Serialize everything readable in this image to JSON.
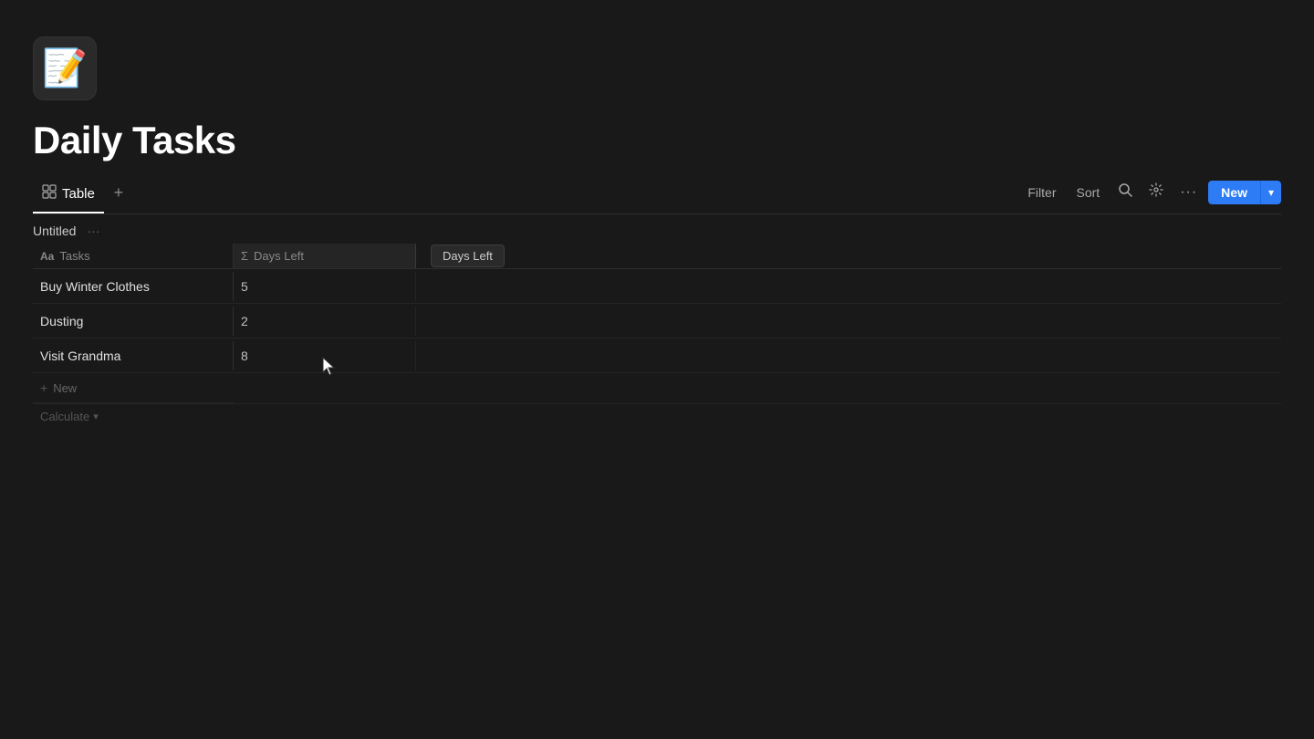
{
  "app": {
    "icon_emoji": "📝",
    "title": "Daily Tasks"
  },
  "tabs": [
    {
      "id": "table",
      "label": "Table",
      "active": true
    }
  ],
  "tabs_add_label": "+",
  "toolbar": {
    "filter_label": "Filter",
    "sort_label": "Sort",
    "search_icon": "🔍",
    "options_icon": "⚙",
    "more_icon": "···",
    "new_label": "New",
    "new_dropdown_icon": "▾"
  },
  "table": {
    "group_name": "Untitled",
    "group_more_icon": "···",
    "columns": [
      {
        "id": "tasks",
        "type_label": "Aa",
        "label": "Tasks"
      },
      {
        "id": "days_left",
        "type_label": "Σ",
        "label": "Days Left"
      }
    ],
    "column_pill_label": "Days Left",
    "rows": [
      {
        "task": "Buy Winter Clothes",
        "days_left": "5"
      },
      {
        "task": "Dusting",
        "days_left": "2"
      },
      {
        "task": "Visit Grandma",
        "days_left": "8"
      }
    ],
    "new_row_label": "New",
    "calculate_label": "Calculate"
  }
}
